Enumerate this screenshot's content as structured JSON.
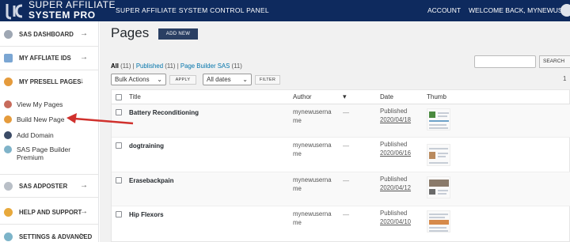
{
  "topbar": {
    "logo_line1": "SUPER AFFILIATE",
    "logo_line2": "SYSTEM PRO",
    "panel_title": "SUPER AFFILIATE SYSTEM CONTROL PANEL",
    "account": "ACCOUNT",
    "welcome": "WELCOME BACK, MYNEWUSERNAME"
  },
  "sidebar": {
    "items": [
      {
        "label": "SAS DASHBOARD",
        "arrow": "→",
        "icon": "dashboard-icon",
        "color": "#9ea7b3"
      },
      {
        "label": "MY AFFLIATE IDS",
        "arrow": "→",
        "icon": "ids-icon",
        "color": "#7ba6d3"
      },
      {
        "label": "MY PRESELL PAGES",
        "arrow": "↓",
        "icon": "presell-icon",
        "color": "#e59b3c"
      },
      {
        "label": "SAS ADPOSTER",
        "arrow": "→",
        "icon": "adposter-icon",
        "color": "#b9bfc7"
      },
      {
        "label": "HELP AND SUPPORT",
        "arrow": "→",
        "icon": "help-icon",
        "color": "#e8a93c"
      },
      {
        "label": "SETTINGS & ADVANCED",
        "arrow": ">",
        "icon": "settings-icon",
        "color": "#7cb4c9"
      }
    ],
    "sub_items": [
      {
        "label": "View My Pages",
        "icon": "view-pages-icon",
        "color": "#c76b5b"
      },
      {
        "label": "Build New Page",
        "icon": "build-page-icon",
        "color": "#e59b3c"
      },
      {
        "label": "Add Domain",
        "icon": "domain-icon",
        "color": "#3b4b66"
      },
      {
        "label": "SAS Page Builder Premium",
        "icon": "builder-icon",
        "color": "#7fb3c9"
      }
    ]
  },
  "main": {
    "title": "Pages",
    "add_new": "ADD NEW",
    "filter_all": "All",
    "filter_all_count": "(11)",
    "filter_sep1": "|",
    "filter_published": "Published",
    "filter_published_count": "(11)",
    "filter_sep2": "|",
    "filter_builder": "Page Builder SAS",
    "filter_builder_count": "(11)",
    "search_button": "SEARCH",
    "bulk_actions": "Bulk Actions",
    "apply": "APPLY",
    "all_dates": "All dates",
    "filter_button": "FILTER",
    "page_count": "1",
    "columns": {
      "title": "Title",
      "author": "Author",
      "date": "Date",
      "thumb": "Thumb"
    },
    "rows": [
      {
        "title": "Battery Reconditioning",
        "author": "mynewusername",
        "comments": "—",
        "status": "Published",
        "date": "2020/04/18"
      },
      {
        "title": "dogtraining",
        "author": "mynewusername",
        "comments": "—",
        "status": "Published",
        "date": "2020/06/16"
      },
      {
        "title": "Erasebackpain",
        "author": "mynewusername",
        "comments": "—",
        "status": "Published",
        "date": "2020/04/12"
      },
      {
        "title": "Hip Flexors",
        "author": "mynewusername",
        "comments": "—",
        "status": "Published",
        "date": "2020/04/10"
      }
    ]
  },
  "colors": {
    "topbar": "#0e2a5e",
    "add_new_button": "#2a3f63",
    "annotation_arrow": "#d0312d",
    "link": "#0073aa"
  }
}
